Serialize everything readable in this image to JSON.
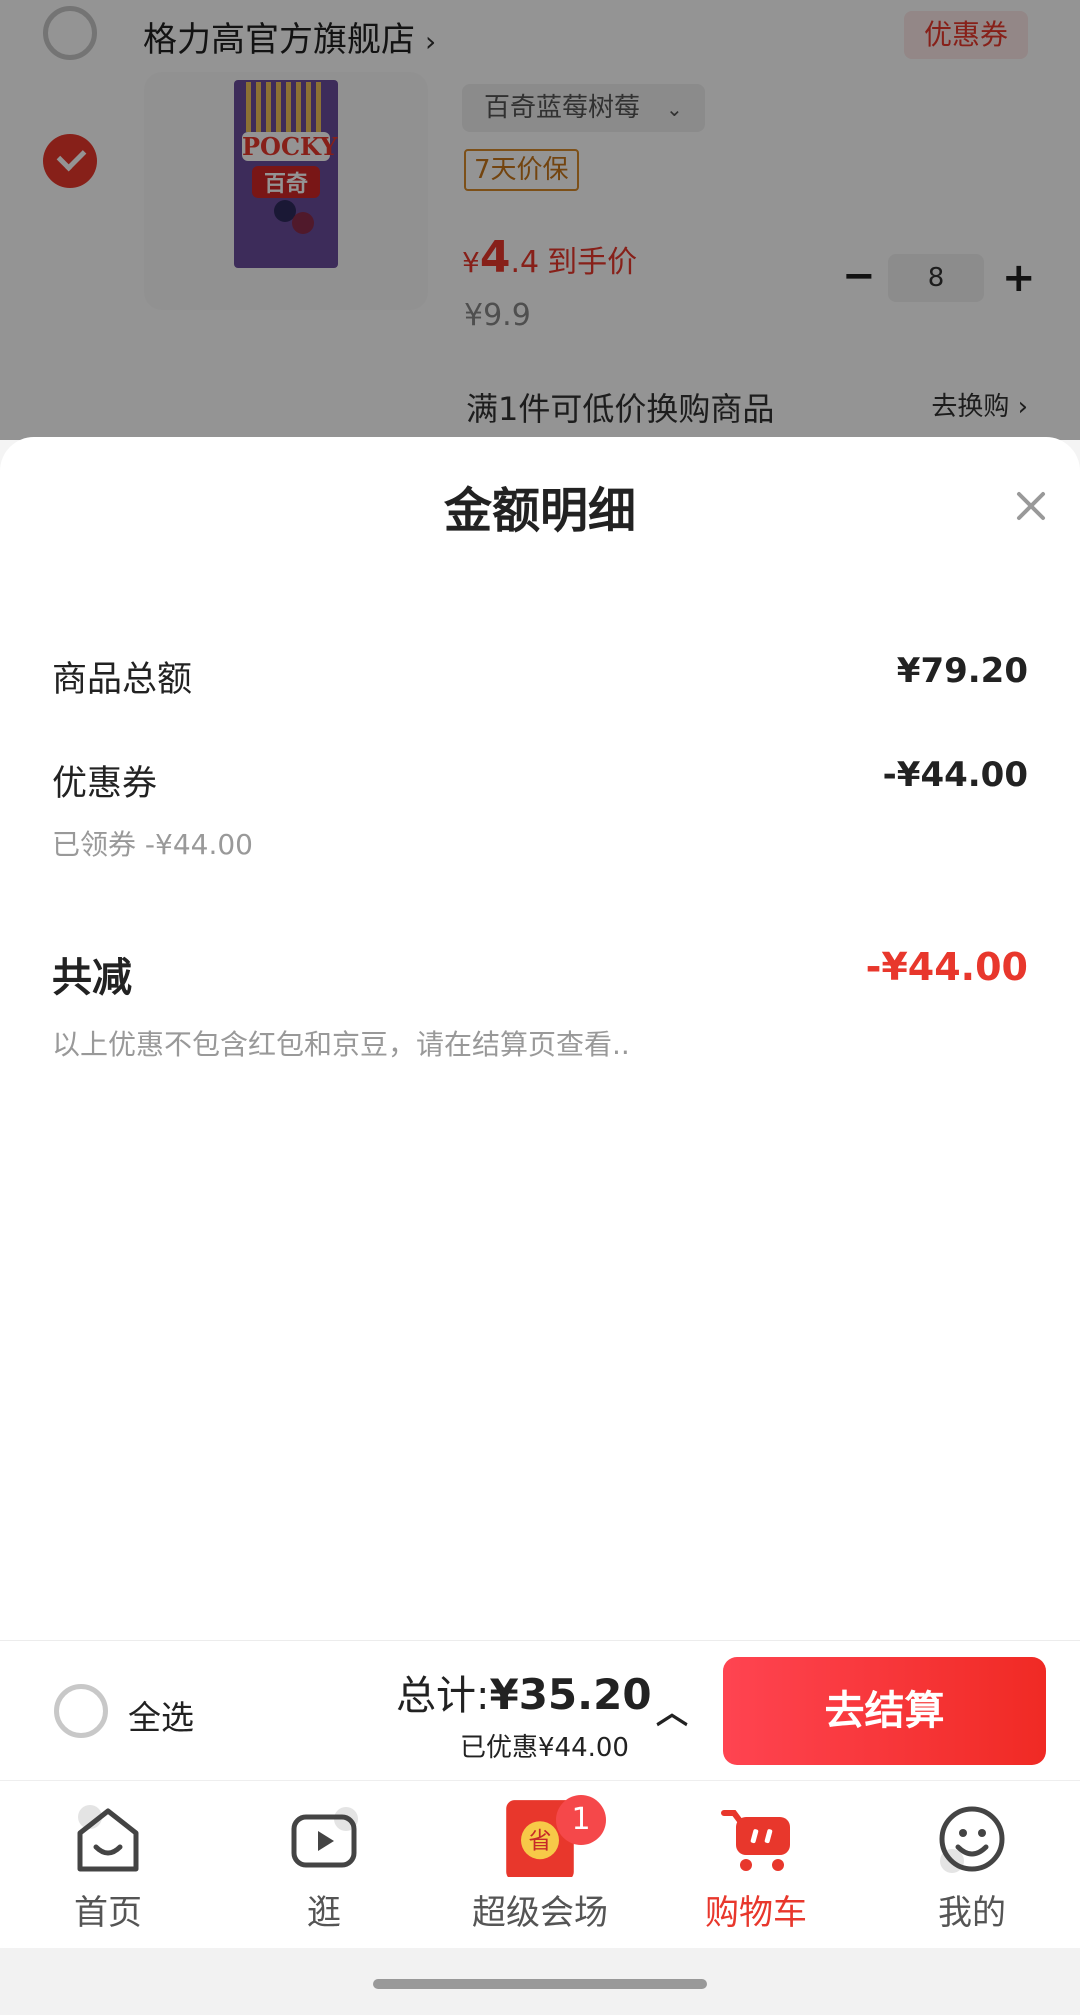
{
  "store": {
    "name": "格力高官方旗舰店",
    "chevron": "›",
    "coupon_tag": "优惠券"
  },
  "product": {
    "box_brand": "POCKY",
    "box_brand_cn": "百奇",
    "variant": "百奇蓝莓树莓",
    "variant_chevron": "⌄",
    "price_guarantee": "7天价保",
    "price_yen": "¥",
    "price_int": "4",
    "price_dec": ".4",
    "price_label": "到手价",
    "original_price": "¥9.9",
    "minus": "−",
    "quantity": "8",
    "plus": "+",
    "promo_text": "满1件可低价换购商品",
    "promo_link": "去换购 ›"
  },
  "sheet": {
    "title": "金额明细",
    "goods_total_label": "商品总额",
    "goods_total_value": "¥79.20",
    "coupon_label": "优惠券",
    "coupon_value": "-¥44.00",
    "coupon_sub": "已领券 -¥44.00",
    "total_reduce_label": "共减",
    "total_reduce_value": "-¥44.00",
    "note": "以上优惠不包含红包和京豆，请在结算页查看.."
  },
  "checkout": {
    "select_all": "全选",
    "total_prefix": "总计:",
    "total_amount": "¥35.20",
    "saved": "已优惠¥44.00",
    "chevron": "︿",
    "button": "去结算"
  },
  "nav": {
    "items": [
      {
        "label": "首页",
        "icon": "home-icon"
      },
      {
        "label": "逛",
        "icon": "video-play-icon"
      },
      {
        "label": "超级会场",
        "icon": "red-envelope-icon",
        "badge": "1",
        "icon_char": "省"
      },
      {
        "label": "购物车",
        "icon": "cart-icon",
        "active": true
      },
      {
        "label": "我的",
        "icon": "smiley-profile-icon"
      }
    ]
  },
  "colors": {
    "accent": "#e8372c",
    "overlay": "rgba(0,0,0,0.42)"
  }
}
